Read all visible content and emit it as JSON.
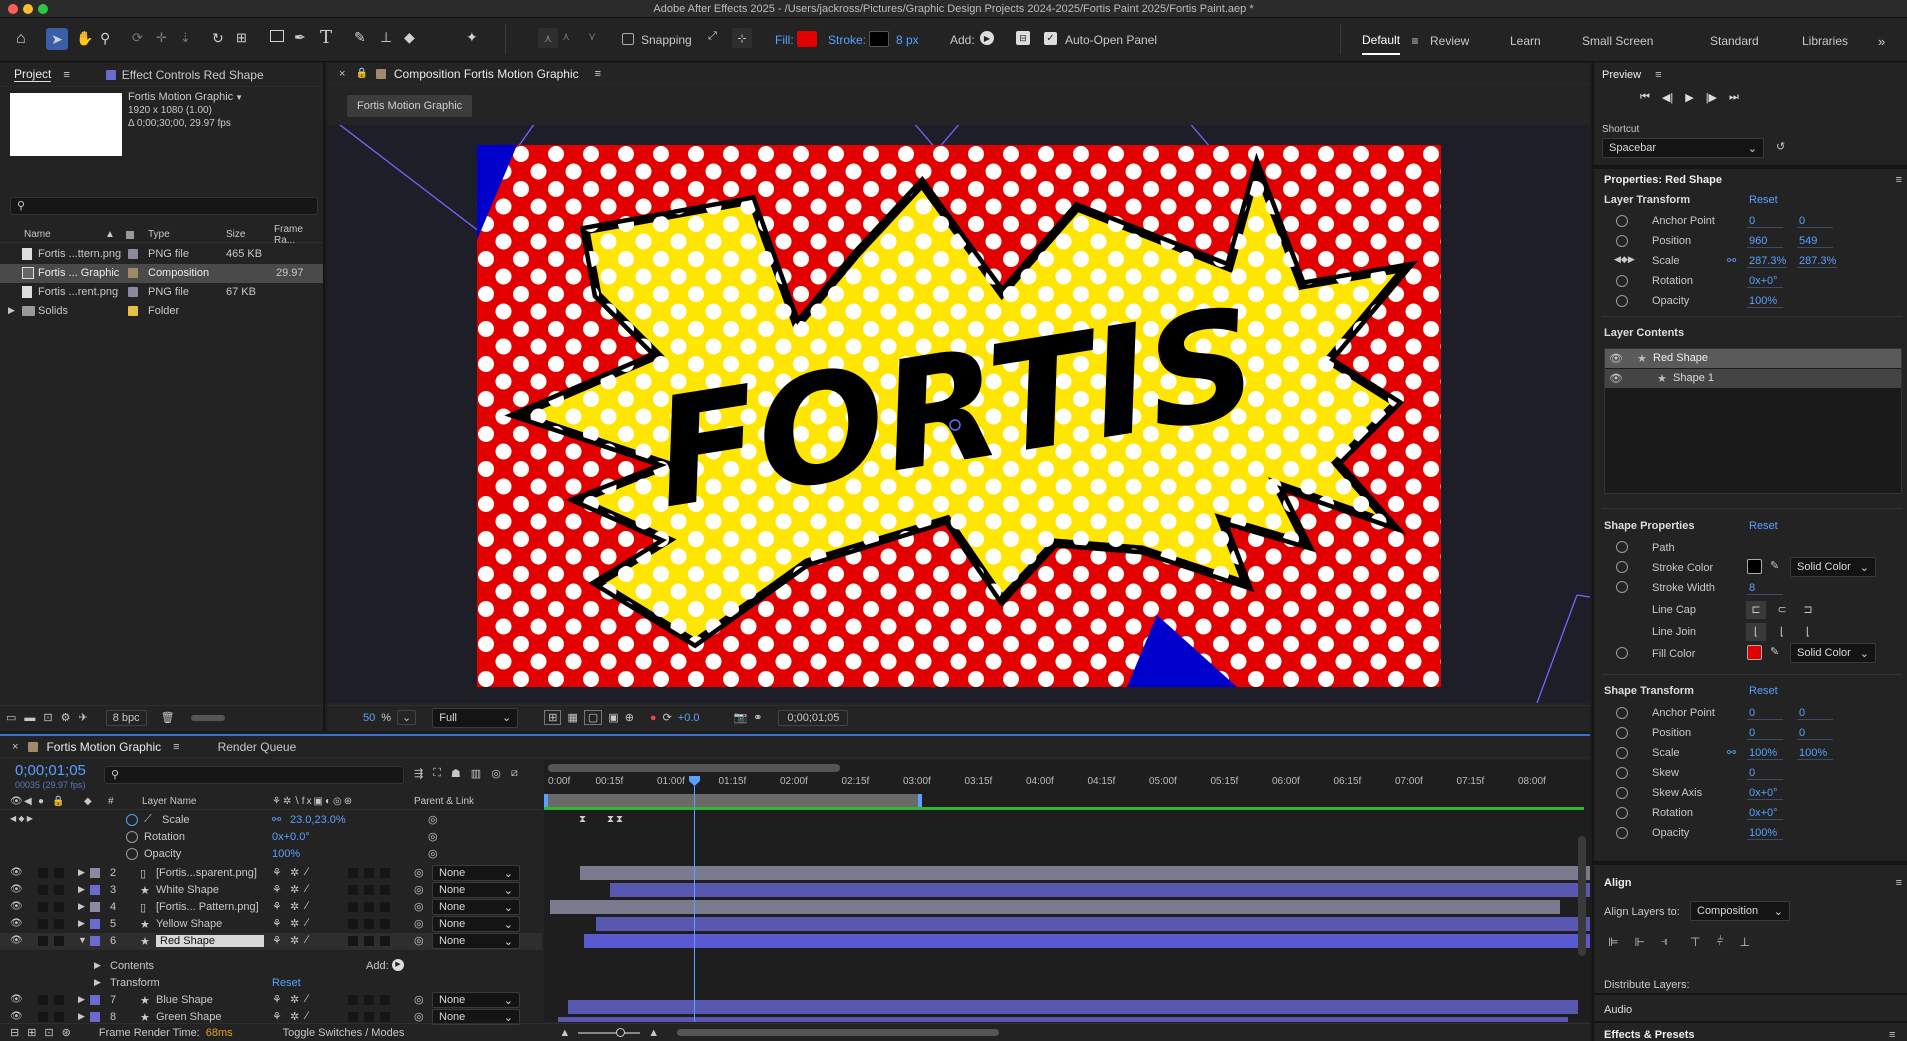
{
  "window": {
    "title": "Adobe After Effects 2025 - /Users/jackross/Pictures/Graphic Design Projects 2024-2025/Fortis Paint 2025/Fortis Paint.aep *"
  },
  "toolbar": {
    "snapping": "Snapping",
    "fill_label": "Fill:",
    "stroke_label": "Stroke:",
    "stroke_px": "8 px",
    "add_label": "Add:",
    "auto_open": "Auto-Open Panel",
    "fill_color": "#e00000",
    "stroke_color": "#000000"
  },
  "workspaces": [
    {
      "label": "Default",
      "active": true
    },
    {
      "label": "Review"
    },
    {
      "label": "Learn"
    },
    {
      "label": "Small Screen"
    },
    {
      "label": "Standard"
    },
    {
      "label": "Libraries"
    }
  ],
  "project": {
    "tab_project": "Project",
    "tab_effect": "Effect Controls Red Shape",
    "thumb_name": "Fortis Motion Graphic",
    "thumb_info1": "1920 x 1080 (1.00)",
    "thumb_info2": "Δ 0;00;30;00, 29.97 fps",
    "search_placeholder": "",
    "cols": {
      "name": "Name",
      "type": "Type",
      "size": "Size",
      "rate": "Frame Ra..."
    },
    "items": [
      {
        "name": "Fortis ...ttern.png",
        "type": "PNG file",
        "size": "465 KB",
        "rate": "",
        "color": "#8a8aa0",
        "selected": false
      },
      {
        "name": "Fortis ... Graphic",
        "type": "Composition",
        "size": "",
        "rate": "29.97",
        "color": "#a08a6a",
        "selected": true
      },
      {
        "name": "Fortis ...rent.png",
        "type": "PNG file",
        "size": "67 KB",
        "rate": "",
        "color": "#8a8aa0",
        "selected": false
      },
      {
        "name": "Solids",
        "type": "Folder",
        "size": "",
        "rate": "",
        "color": "#e8c040",
        "selected": false
      }
    ],
    "bpc": "8 bpc"
  },
  "comp": {
    "tab": "Composition Fortis Motion Graphic",
    "subtab": "Fortis Motion Graphic",
    "text": "FORTIS",
    "zoom": "50",
    "zoom_unit": "%",
    "quality": "Full",
    "exposure": "+0.0",
    "timecode": "0;00;01;05"
  },
  "timeline": {
    "tab": "Fortis Motion Graphic",
    "render_queue": "Render Queue",
    "timecode": "0;00;01;05",
    "fps_info": "00035 (29.97 fps)",
    "col_layer": "Layer Name",
    "col_parent": "Parent & Link",
    "ruler": [
      "0:00f",
      "00:15f",
      "01:00f",
      "01:15f",
      "02:00f",
      "02:15f",
      "03:00f",
      "03:15f",
      "04:00f",
      "04:15f",
      "05:00f",
      "05:15f",
      "06:00f",
      "06:15f",
      "07:00f",
      "07:15f",
      "08:00f"
    ],
    "props": [
      {
        "name": "Scale",
        "val": "23.0,23.0%"
      },
      {
        "name": "Rotation",
        "val": "0x+0.0°"
      },
      {
        "name": "Opacity",
        "val": "100%"
      }
    ],
    "layers": [
      {
        "num": "2",
        "name": "[Fortis...sparent.png]",
        "parent": "None",
        "color": "#8a8aa0",
        "kind": "file"
      },
      {
        "num": "3",
        "name": "White Shape",
        "parent": "None",
        "color": "#6a6ad0",
        "kind": "shape"
      },
      {
        "num": "4",
        "name": "[Fortis... Pattern.png]",
        "parent": "None",
        "color": "#8a8aa0",
        "kind": "file"
      },
      {
        "num": "5",
        "name": "Yellow Shape",
        "parent": "None",
        "color": "#6a6ad0",
        "kind": "shape"
      },
      {
        "num": "6",
        "name": "Red Shape",
        "parent": "None",
        "color": "#6a6ad0",
        "kind": "shape",
        "selected": true
      }
    ],
    "contents": "Contents",
    "add": "Add:",
    "transform": "Transform",
    "reset": "Reset",
    "layers2": [
      {
        "num": "7",
        "name": "Blue Shape",
        "parent": "None"
      },
      {
        "num": "8",
        "name": "Green Shape",
        "parent": "None"
      }
    ],
    "frame_render_label": "Frame Render Time:",
    "frame_render_val": "68ms",
    "toggle": "Toggle Switches / Modes"
  },
  "right": {
    "preview": "Preview",
    "shortcut_label": "Shortcut",
    "shortcut": "Spacebar",
    "props_title": "Properties: Red Shape",
    "layer_transform": "Layer Transform",
    "reset": "Reset",
    "lt": [
      {
        "name": "Anchor Point",
        "v1": "0",
        "v2": "0"
      },
      {
        "name": "Position",
        "v1": "960",
        "v2": "549"
      },
      {
        "name": "Scale",
        "v1": "287.3%",
        "v2": "287.3%"
      },
      {
        "name": "Rotation",
        "v1": "0x+0°",
        "v2": ""
      },
      {
        "name": "Opacity",
        "v1": "100%",
        "v2": ""
      }
    ],
    "layer_contents": "Layer Contents",
    "lc": [
      {
        "name": "Red Shape"
      },
      {
        "name": "Shape 1"
      }
    ],
    "shape_props": "Shape Properties",
    "path": "Path",
    "stroke_color": "Stroke Color",
    "solid_color": "Solid Color",
    "stroke_width": "Stroke Width",
    "stroke_width_val": "8",
    "line_cap": "Line Cap",
    "line_join": "Line Join",
    "fill_color": "Fill Color",
    "shape_transform": "Shape Transform",
    "st": [
      {
        "name": "Anchor Point",
        "v1": "0",
        "v2": "0"
      },
      {
        "name": "Position",
        "v1": "0",
        "v2": "0"
      },
      {
        "name": "Scale",
        "v1": "100%",
        "v2": "100%"
      },
      {
        "name": "Skew",
        "v1": "0",
        "v2": ""
      },
      {
        "name": "Skew Axis",
        "v1": "0x+0°",
        "v2": ""
      },
      {
        "name": "Rotation",
        "v1": "0x+0°",
        "v2": ""
      },
      {
        "name": "Opacity",
        "v1": "100%",
        "v2": ""
      }
    ],
    "align": "Align",
    "align_to_label": "Align Layers to:",
    "align_to": "Composition",
    "distribute": "Distribute Layers:",
    "audio": "Audio",
    "effects": "Effects & Presets"
  }
}
